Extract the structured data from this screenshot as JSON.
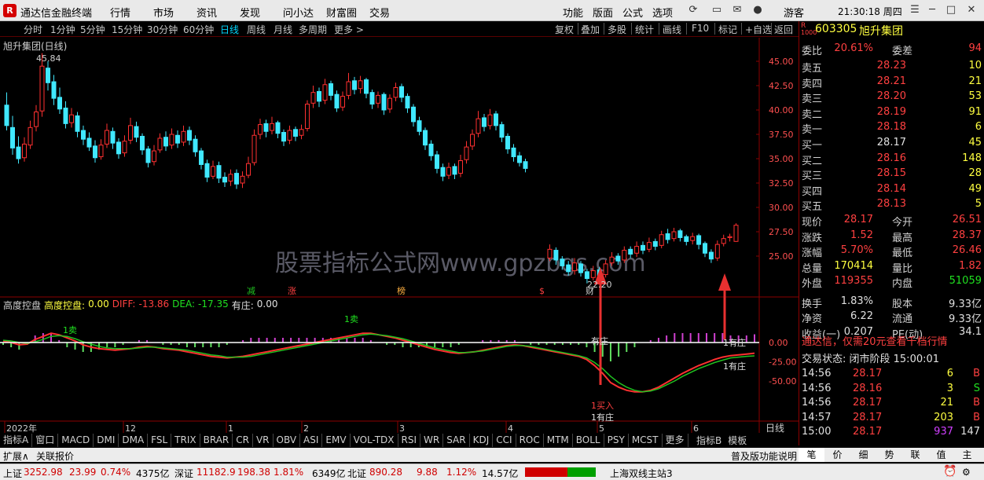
{
  "app": {
    "logo_glyph": "R",
    "title": "通达信金融终端",
    "menus": [
      "行情",
      "市场",
      "资讯",
      "发现",
      "问小达",
      "财富圈",
      "交易"
    ],
    "right_menus": [
      "功能",
      "版面",
      "公式",
      "选项"
    ],
    "guest": "游客",
    "clock": "21:30:18 周四"
  },
  "periods": [
    "分时",
    "1分钟",
    "5分钟",
    "15分钟",
    "30分钟",
    "60分钟",
    "日线",
    "周线",
    "月线",
    "多周期",
    "更多 >"
  ],
  "active_period": "日线",
  "tools": [
    "复权",
    "叠加",
    "多股",
    "统计",
    "画线",
    "F10",
    "标记",
    "+自选",
    "返回"
  ],
  "chart": {
    "title": "旭升集团(日线)",
    "price_axis": [
      "45.00",
      "42.50",
      "40.00",
      "37.50",
      "35.00",
      "32.50",
      "30.00",
      "27.50",
      "25.00"
    ],
    "high_label": "45.84",
    "low_label": "22.20",
    "watermark": "股票指标公式网www.gpzbgs.com",
    "markers": [
      "减",
      "涨",
      "榜",
      "$",
      "财"
    ],
    "indicator_label": "高度控盘",
    "indicator_values": {
      "ctrl_name": "高度控盘:",
      "ctrl": "0.00",
      "diff_name": "DIFF:",
      "diff": "-13.86",
      "dea_name": "DEA:",
      "dea": "-17.35",
      "zhuang_name": "有庄:",
      "zhuang": "0.00"
    },
    "ind_axis": [
      "0.00",
      "-25.00",
      "-50.00"
    ],
    "ind_annotations": {
      "sell": "1卖",
      "have": "有庄",
      "have1": "1有庄",
      "buy": "1买入",
      "have2": "1有庄",
      "have3": "1有庄"
    },
    "date_axis": [
      "2022年",
      "12",
      "1",
      "2",
      "3",
      "4",
      "5",
      "6"
    ],
    "date_unit": "日线"
  },
  "stock": {
    "code": "603305",
    "name": "旭升集团",
    "r_badge": "R",
    "r_num": "1000"
  },
  "orderbook": {
    "weibi_label": "委比",
    "weibi": "20.61%",
    "weicha_label": "委差",
    "weicha": "94",
    "asks": [
      {
        "l": "卖五",
        "p": "28.23",
        "v": "10"
      },
      {
        "l": "卖四",
        "p": "28.21",
        "v": "21"
      },
      {
        "l": "卖三",
        "p": "28.20",
        "v": "53"
      },
      {
        "l": "卖二",
        "p": "28.19",
        "v": "91"
      },
      {
        "l": "卖一",
        "p": "28.18",
        "v": "6"
      }
    ],
    "bids": [
      {
        "l": "买一",
        "p": "28.17",
        "v": "45"
      },
      {
        "l": "买二",
        "p": "28.16",
        "v": "148"
      },
      {
        "l": "买三",
        "p": "28.15",
        "v": "28"
      },
      {
        "l": "买四",
        "p": "28.14",
        "v": "49"
      },
      {
        "l": "买五",
        "p": "28.13",
        "v": "5"
      }
    ]
  },
  "quote": [
    {
      "l": "现价",
      "v": "28.17",
      "l2": "今开",
      "v2": "26.51"
    },
    {
      "l": "涨跌",
      "v": "1.52",
      "l2": "最高",
      "v2": "28.37"
    },
    {
      "l": "涨幅",
      "v": "5.70%",
      "l2": "最低",
      "v2": "26.46"
    },
    {
      "l": "总量",
      "v": "170414",
      "l2": "量比",
      "v2": "1.82"
    },
    {
      "l": "外盘",
      "v": "119355",
      "l2": "内盘",
      "v2": "51059"
    },
    {
      "l": "换手",
      "v": "1.83%",
      "l2": "股本",
      "v2": "9.33亿"
    },
    {
      "l": "净资",
      "v": "6.22",
      "l2": "流通",
      "v2": "9.33亿"
    },
    {
      "l": "收益(一)",
      "v": "0.207",
      "l2": "PE(动)",
      "v2": "34.1"
    }
  ],
  "promo": "通达信，仅需20元查看千档行情",
  "trade_status": "交易状态: 闭市阶段 15:00:01",
  "ticks": [
    {
      "t": "14:56",
      "p": "28.17",
      "v": "6",
      "s": "B"
    },
    {
      "t": "14:56",
      "p": "28.16",
      "v": "3",
      "s": "S"
    },
    {
      "t": "14:56",
      "p": "28.17",
      "v": "21",
      "s": "B"
    },
    {
      "t": "14:57",
      "p": "28.17",
      "v": "203",
      "s": "B"
    },
    {
      "t": "15:00",
      "p": "28.17",
      "v": "937",
      "s": "147"
    }
  ],
  "indicator_tabs": [
    "指标A",
    "窗口",
    "MACD",
    "DMI",
    "DMA",
    "FSL",
    "TRIX",
    "BRAR",
    "CR",
    "VR",
    "OBV",
    "ASI",
    "EMV",
    "VOL-TDX",
    "RSI",
    "WR",
    "SAR",
    "KDJ",
    "CCI",
    "ROC",
    "MTM",
    "BOLL",
    "PSY",
    "MCST",
    "更多"
  ],
  "tab_right": [
    "指标B",
    "模板"
  ],
  "ext_tabs": [
    "扩展∧",
    "关联报价"
  ],
  "ext_right": "普及版功能说明",
  "rp_tabs": [
    "笔",
    "价",
    "细",
    "势",
    "联",
    "值",
    "主"
  ],
  "status": {
    "sh_label": "上证",
    "sh": "3252.98",
    "sh_chg": "23.99",
    "sh_pct": "0.74%",
    "sh_amt": "4375亿",
    "sz_label": "深证",
    "sz": "11182.9",
    "sz_chg": "198.38",
    "sz_pct": "1.81%",
    "sz_amt": "6349亿",
    "bz_label": "北证",
    "bz": "890.28",
    "bz_chg": "9.88",
    "bz_pct": "1.12%",
    "bz_amt": "14.57亿",
    "server": "上海双线主站3"
  },
  "colors": {
    "up": "#ff4040",
    "down": "#40ffff",
    "axis": "#8b0000"
  },
  "kline": [
    [
      40.5,
      38.4,
      41.8,
      37.9
    ],
    [
      38.2,
      36.1,
      39.4,
      35.4
    ],
    [
      36.2,
      35.0,
      37.3,
      34.5
    ],
    [
      35.1,
      36.5,
      37.2,
      34.7
    ],
    [
      36.4,
      38.2,
      38.9,
      36.0
    ],
    [
      38.3,
      39.8,
      40.5,
      37.8
    ],
    [
      39.9,
      44.5,
      45.84,
      39.3
    ],
    [
      44.3,
      42.8,
      45.0,
      42.0
    ],
    [
      42.9,
      41.2,
      43.6,
      40.5
    ],
    [
      41.3,
      40.1,
      42.3,
      39.6
    ],
    [
      40.2,
      38.6,
      40.9,
      38.1
    ],
    [
      38.7,
      39.5,
      40.2,
      38.2
    ],
    [
      39.4,
      37.8,
      39.8,
      37.2
    ],
    [
      37.9,
      37.0,
      38.4,
      36.4
    ],
    [
      37.1,
      36.2,
      37.7,
      35.8
    ],
    [
      36.3,
      35.1,
      36.9,
      34.6
    ],
    [
      35.2,
      36.4,
      37.0,
      34.9
    ],
    [
      36.5,
      37.9,
      38.6,
      36.1
    ],
    [
      37.8,
      36.6,
      38.2,
      36.0
    ],
    [
      36.7,
      35.5,
      37.1,
      35.0
    ],
    [
      35.6,
      36.8,
      37.4,
      35.2
    ],
    [
      36.9,
      38.4,
      39.2,
      36.5
    ],
    [
      38.3,
      37.2,
      38.8,
      36.7
    ],
    [
      37.3,
      35.9,
      37.6,
      35.4
    ],
    [
      36.0,
      34.6,
      36.3,
      34.1
    ],
    [
      34.7,
      35.8,
      36.4,
      34.3
    ],
    [
      35.9,
      37.1,
      37.6,
      35.6
    ],
    [
      37.2,
      36.3,
      37.8,
      35.8
    ],
    [
      36.4,
      37.5,
      38.1,
      36.0
    ],
    [
      37.4,
      36.6,
      37.9,
      36.1
    ],
    [
      36.7,
      37.8,
      38.4,
      36.3
    ],
    [
      37.9,
      36.9,
      38.3,
      36.4
    ],
    [
      37.0,
      35.7,
      37.4,
      35.2
    ],
    [
      35.8,
      34.4,
      36.1,
      33.9
    ],
    [
      34.5,
      33.1,
      34.9,
      32.6
    ],
    [
      33.2,
      34.2,
      34.8,
      32.9
    ],
    [
      34.3,
      33.0,
      34.7,
      32.5
    ],
    [
      33.1,
      32.6,
      33.6,
      32.1
    ],
    [
      32.7,
      33.4,
      33.9,
      32.2
    ],
    [
      33.5,
      32.4,
      33.9,
      31.9
    ],
    [
      32.5,
      33.2,
      33.7,
      32.0
    ],
    [
      33.3,
      34.5,
      35.2,
      33.0
    ],
    [
      34.6,
      37.4,
      38.0,
      34.3
    ],
    [
      37.5,
      38.5,
      39.1,
      37.0
    ],
    [
      38.6,
      37.8,
      39.0,
      37.2
    ],
    [
      37.9,
      38.6,
      39.3,
      37.5
    ],
    [
      38.7,
      37.6,
      38.9,
      37.1
    ],
    [
      37.7,
      36.8,
      38.0,
      36.3
    ],
    [
      36.9,
      37.9,
      38.4,
      36.5
    ],
    [
      38.0,
      37.3,
      38.3,
      36.8
    ],
    [
      37.4,
      38.0,
      38.5,
      37.0
    ],
    [
      38.1,
      40.6,
      41.0,
      37.8
    ],
    [
      40.7,
      41.8,
      42.5,
      40.2
    ],
    [
      41.9,
      40.9,
      42.3,
      40.3
    ],
    [
      41.0,
      42.6,
      43.2,
      40.6
    ],
    [
      42.7,
      41.5,
      43.0,
      41.0
    ],
    [
      41.6,
      40.2,
      42.0,
      39.8
    ],
    [
      40.3,
      41.4,
      41.9,
      39.9
    ],
    [
      41.5,
      42.9,
      43.8,
      41.1
    ],
    [
      43.0,
      42.1,
      43.4,
      41.6
    ],
    [
      42.2,
      43.0,
      43.5,
      41.7
    ],
    [
      43.1,
      41.7,
      43.3,
      41.2
    ],
    [
      41.8,
      40.6,
      42.1,
      40.1
    ],
    [
      40.7,
      41.5,
      41.9,
      40.2
    ],
    [
      41.6,
      40.0,
      41.8,
      39.5
    ],
    [
      40.1,
      41.2,
      41.6,
      39.7
    ],
    [
      41.3,
      42.3,
      42.8,
      40.9
    ],
    [
      42.4,
      41.3,
      42.7,
      40.8
    ],
    [
      41.4,
      40.2,
      41.7,
      39.7
    ],
    [
      40.3,
      38.8,
      40.6,
      38.3
    ],
    [
      38.9,
      37.8,
      39.3,
      37.4
    ],
    [
      37.9,
      36.4,
      38.2,
      35.9
    ],
    [
      36.5,
      35.3,
      36.9,
      34.8
    ],
    [
      35.4,
      34.0,
      35.8,
      33.5
    ],
    [
      34.1,
      33.2,
      34.5,
      32.7
    ],
    [
      33.3,
      34.1,
      34.6,
      32.9
    ],
    [
      34.2,
      33.4,
      34.5,
      32.9
    ],
    [
      33.5,
      34.8,
      35.4,
      33.1
    ],
    [
      34.9,
      36.2,
      36.8,
      34.5
    ],
    [
      36.3,
      37.5,
      38.0,
      35.9
    ],
    [
      37.6,
      39.1,
      39.9,
      37.2
    ],
    [
      39.2,
      38.3,
      39.6,
      37.8
    ],
    [
      38.4,
      39.5,
      40.1,
      38.0
    ],
    [
      39.6,
      38.4,
      39.9,
      37.9
    ],
    [
      38.5,
      37.2,
      38.8,
      36.7
    ],
    [
      37.3,
      36.0,
      37.6,
      35.5
    ],
    [
      36.1,
      35.2,
      36.5,
      34.7
    ],
    [
      35.3,
      34.6,
      35.7,
      34.2
    ],
    [
      34.7,
      34.0,
      35.0,
      33.6
    ]
  ],
  "kline2": [
    [
      24.8,
      25.7,
      26.2,
      24.5
    ],
    [
      25.6,
      24.6,
      25.9,
      24.1
    ],
    [
      24.7,
      24.0,
      25.0,
      23.6
    ],
    [
      24.1,
      23.4,
      24.5,
      23.0
    ],
    [
      23.5,
      24.3,
      24.8,
      23.1
    ],
    [
      24.2,
      23.3,
      24.5,
      22.9
    ],
    [
      23.4,
      22.7,
      23.7,
      22.2
    ],
    [
      22.8,
      23.5,
      24.0,
      22.5
    ],
    [
      23.6,
      23.0,
      23.9,
      22.6
    ],
    [
      23.1,
      24.2,
      24.6,
      22.8
    ],
    [
      24.3,
      24.9,
      25.4,
      24.0
    ],
    [
      25.0,
      24.5,
      25.3,
      24.1
    ],
    [
      24.6,
      25.6,
      26.0,
      24.3
    ],
    [
      25.7,
      25.2,
      26.0,
      24.8
    ],
    [
      25.3,
      26.0,
      26.5,
      24.9
    ],
    [
      26.1,
      25.6,
      26.5,
      25.2
    ],
    [
      25.7,
      26.4,
      26.9,
      25.4
    ],
    [
      26.5,
      26.0,
      26.8,
      25.6
    ],
    [
      26.1,
      27.2,
      27.6,
      25.8
    ],
    [
      27.3,
      26.7,
      27.8,
      26.3
    ],
    [
      26.8,
      27.5,
      27.9,
      26.5
    ],
    [
      27.6,
      26.9,
      27.8,
      26.5
    ],
    [
      27.0,
      26.5,
      27.2,
      26.1
    ],
    [
      26.6,
      27.0,
      27.4,
      26.2
    ],
    [
      27.1,
      26.2,
      27.3,
      25.7
    ],
    [
      26.3,
      25.3,
      26.5,
      24.9
    ],
    [
      25.4,
      24.7,
      25.7,
      24.3
    ],
    [
      24.8,
      26.2,
      26.6,
      24.5
    ],
    [
      26.3,
      26.8,
      27.2,
      26.0
    ],
    [
      26.9,
      27.0,
      27.3,
      26.5
    ],
    [
      26.51,
      28.17,
      28.37,
      26.46
    ]
  ],
  "diff": [
    2,
    0,
    -3,
    -2,
    4,
    8,
    12,
    10,
    6,
    2,
    -3,
    -6,
    -8,
    -9,
    -10,
    -9,
    -8,
    -6,
    -5,
    -6,
    -8,
    -9,
    -10,
    -12,
    -14,
    -16,
    -18,
    -19,
    -20,
    -19,
    -18,
    -16,
    -14,
    -12,
    -10,
    -8,
    -6,
    -4,
    -2,
    0,
    2,
    4,
    6,
    8,
    10,
    12,
    12,
    10,
    8,
    6,
    3,
    0,
    -3,
    -6,
    -9,
    -11,
    -13,
    -14,
    -13,
    -12,
    -10,
    -8,
    -6,
    -4,
    -3,
    -4,
    -6,
    -8,
    -10,
    -12,
    -14,
    -16,
    -18,
    -22,
    -30,
    -40,
    -52,
    -58,
    -62,
    -64,
    -64,
    -62,
    -58,
    -52,
    -46,
    -40,
    -35,
    -30,
    -26,
    -22,
    -19,
    -17,
    -16,
    -15,
    -13.86
  ],
  "dea": [
    3,
    2,
    0,
    -1,
    1,
    4,
    8,
    9,
    8,
    5,
    1,
    -2,
    -5,
    -7,
    -8,
    -8,
    -8,
    -7,
    -6,
    -6,
    -7,
    -8,
    -9,
    -10,
    -12,
    -14,
    -16,
    -17,
    -19,
    -19,
    -19,
    -18,
    -16,
    -14,
    -12,
    -10,
    -8,
    -6,
    -4,
    -2,
    0,
    2,
    4,
    6,
    8,
    10,
    11,
    10,
    9,
    7,
    5,
    2,
    -1,
    -4,
    -7,
    -9,
    -11,
    -13,
    -13,
    -12,
    -11,
    -9,
    -7,
    -5,
    -4,
    -4,
    -5,
    -7,
    -9,
    -11,
    -13,
    -15,
    -17,
    -20,
    -26,
    -34,
    -44,
    -52,
    -58,
    -62,
    -64,
    -63,
    -60,
    -55,
    -50,
    -44,
    -39,
    -34,
    -30,
    -26,
    -23,
    -20,
    -19,
    -18,
    -17.35
  ]
}
